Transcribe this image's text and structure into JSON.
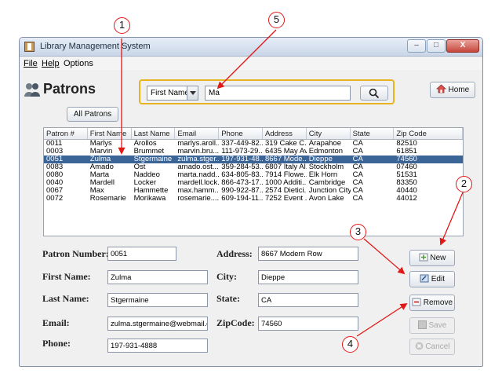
{
  "window": {
    "title": "Library Management System",
    "buttons": [
      "–",
      "□",
      "X"
    ]
  },
  "menu": [
    {
      "label": "File"
    },
    {
      "label": "Help"
    },
    {
      "label": "Options"
    }
  ],
  "header": {
    "title": "Patrons",
    "icon": "people-icon",
    "all_patrons_label": "All Patrons",
    "home_label": "Home",
    "home_icon": "house-icon"
  },
  "search": {
    "field_selected": "First Name",
    "query": "Ma",
    "button_icon": "search-icon",
    "panel_color": "#e8b320"
  },
  "table": {
    "columns": [
      "Patron #",
      "First Name",
      "Last Name",
      "Email",
      "Phone",
      "Address",
      "City",
      "State",
      "Zip Code"
    ],
    "rows": [
      [
        "0011",
        "Marlys",
        "Arollos",
        "marlys.aroll...",
        "337-449-82...",
        "319 Cake C...",
        "Arapahoe",
        "CA",
        "82510"
      ],
      [
        "0003",
        "Marvin",
        "Brummet",
        "marvin.bru...",
        "111-973-29...",
        "6435 May Av...",
        "Edmonton",
        "CA",
        "61851"
      ],
      [
        "0051",
        "Zulma",
        "Stgermaine",
        "zulma.stger...",
        "197-931-48...",
        "8667 Mode...",
        "Dieppe",
        "CA",
        "74560"
      ],
      [
        "0083",
        "Amado",
        "Ost",
        "amado.ost...",
        "359-284-53...",
        "6807 Italy Al...",
        "Stockholm",
        "CA",
        "07460"
      ],
      [
        "0080",
        "Marta",
        "Naddeo",
        "marta.nadd...",
        "634-805-83...",
        "7914 Flowe...",
        "Elk Horn",
        "CA",
        "51531"
      ],
      [
        "0040",
        "Mardell",
        "Locker",
        "mardell.lock...",
        "866-473-17...",
        "1000 Additi...",
        "Cambridge",
        "CA",
        "83350"
      ],
      [
        "0067",
        "Max",
        "Hammette",
        "max.hamm...",
        "990-922-87...",
        "2574 Dietici...",
        "Junction City",
        "CA",
        "40440"
      ],
      [
        "0072",
        "Rosemarie",
        "Morikawa",
        "rosemarie....",
        "609-194-11...",
        "7252 Event ...",
        "Avon Lake",
        "CA",
        "44012"
      ]
    ],
    "selected_row": 2,
    "selected_color": "#3c6597"
  },
  "form": {
    "patron_number": {
      "label": "Patron Number:",
      "value": "0051"
    },
    "first_name": {
      "label": "First Name:",
      "value": "Zulma"
    },
    "last_name": {
      "label": "Last Name:",
      "value": "Stgermaine"
    },
    "email": {
      "label": "Email:",
      "value": "zulma.stgermaine@webmail.com"
    },
    "phone": {
      "label": "Phone:",
      "value": "197-931-4888"
    },
    "address": {
      "label": "Address:",
      "value": "8667 Modern Row"
    },
    "city": {
      "label": "City:",
      "value": "Dieppe"
    },
    "state": {
      "label": "State:",
      "value": "CA"
    },
    "zipcode": {
      "label": "ZipCode:",
      "value": "74560"
    }
  },
  "actions": {
    "new": "New",
    "edit": "Edit",
    "remove": "Remove",
    "save": "Save",
    "cancel": "Cancel"
  },
  "annotations": {
    "a1": "1",
    "a2": "2",
    "a3": "3",
    "a4": "4",
    "a5": "5",
    "color": "#e21717"
  }
}
